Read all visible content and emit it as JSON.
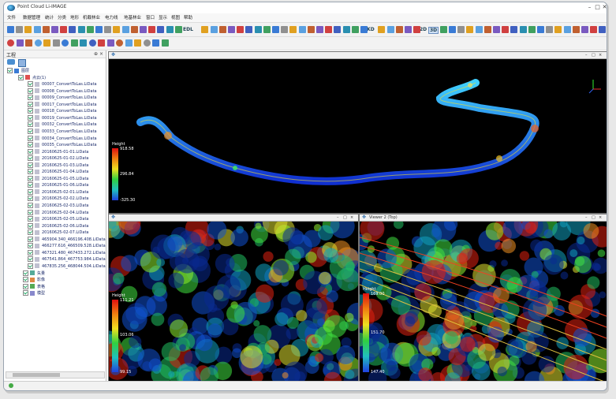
{
  "app": {
    "title": "Point Cloud Li-IMAGE"
  },
  "menu": [
    "文件",
    "数据管理",
    "统计",
    "分类",
    "地形",
    "机载林业",
    "电力线",
    "地基林业",
    "窗口",
    "显示",
    "视图",
    "帮助"
  ],
  "toolbar_text": {
    "ekd": "EKD",
    "edl": "EDL",
    "btn_2d": "2D",
    "btn_3d": "3D"
  },
  "left_panel": {
    "title": "工程",
    "root": "图层",
    "group": "点云(1)",
    "files": [
      "00007_ConvertToLas.LiData",
      "00008_ConvertToLas.LiData",
      "00009_ConvertToLas.LiData",
      "00017_ConvertToLas.LiData",
      "00018_ConvertToLas.LiData",
      "00019_ConvertToLas.LiData",
      "00032_ConvertToLas.LiData",
      "00033_ConvertToLas.LiData",
      "00034_ConvertToLas.LiData",
      "00035_ConvertToLas.LiData",
      "20160625-01-01.LiData",
      "20160625-01-02.LiData",
      "20160625-01-03.LiData",
      "20160625-01-04.LiData",
      "20160625-01-05.LiData",
      "20160625-01-06.LiData",
      "20160625-02-01.LiData",
      "20160625-02-02.LiData",
      "20160625-02-03.LiData",
      "20160625-02-04.LiData",
      "20160625-02-05.LiData",
      "20160625-02-06.LiData",
      "20160625-02-07.LiData",
      "465904.340_466196.408.LiData",
      "466277.616_466509.528.LiData",
      "467321.480_467433.272.LiData",
      "467541.864_467753.984.LiData",
      "467835.256_468044.504.LiData"
    ],
    "layers": [
      "矢量",
      "影像",
      "表格",
      "模型"
    ]
  },
  "viewports": {
    "top": {
      "legend_title": "Height",
      "legend_max": "918.58",
      "legend_mid": "296.84",
      "legend_min": "-325.30"
    },
    "bottom_left": {
      "legend_title": "Height",
      "legend_max": "111.21",
      "legend_mid": "103.06",
      "legend_min": "99.15"
    },
    "bottom_right": {
      "label": "Viewer 2 (Top)",
      "legend_title": "Height",
      "legend_max": "169.00",
      "legend_mid": "151.70",
      "legend_min": "147.40"
    }
  },
  "colors": {
    "legend_top": "#e01010",
    "legend_bottom": "#2040e0",
    "viewport_bg": "#000000"
  }
}
